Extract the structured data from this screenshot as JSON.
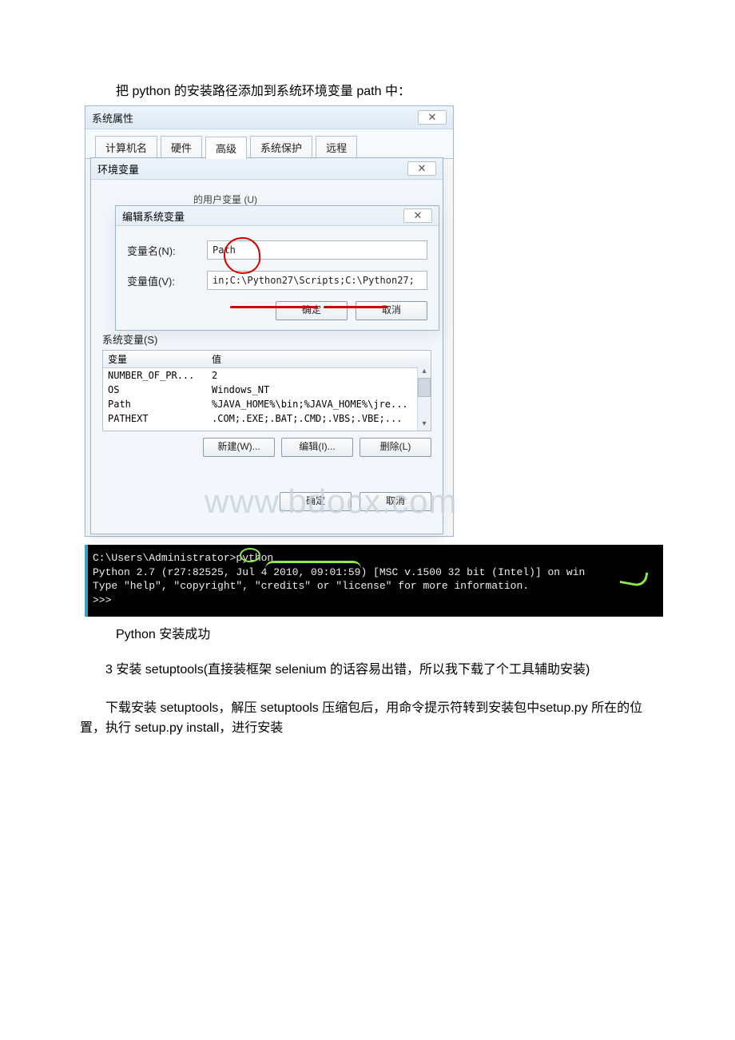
{
  "text": {
    "intro": "把 python 的安装路径添加到系统环境变量 path 中：",
    "caption_success": "Python 安装成功",
    "para_setuptools": "3 安装 setuptools(直接装框架 selenium 的话容易出错，所以我下载了个工具辅助安装)",
    "para_setup_instructions": "下载安装 setuptools，解压 setuptools 压缩包后，用命令提示符转到安装包中setup.py 所在的位置，执行 setup.py install，进行安装"
  },
  "watermark": "www.bdocx.com",
  "sysprop": {
    "title": "系统属性",
    "close": "✕",
    "tabs": {
      "t1": "计算机名",
      "t2": "硬件",
      "t3": "高级",
      "t4": "系统保护",
      "t5": "远程"
    }
  },
  "env": {
    "title": "环境变量",
    "close": "✕",
    "partial_user_vars": "的用户变量 (U)",
    "sysvars_label": "系统变量(S)",
    "col_var": "变量",
    "col_val": "值",
    "rows": [
      {
        "k": "NUMBER_OF_PR...",
        "v": "2"
      },
      {
        "k": "OS",
        "v": "Windows_NT"
      },
      {
        "k": "Path",
        "v": "%JAVA_HOME%\\bin;%JAVA_HOME%\\jre..."
      },
      {
        "k": "PATHEXT",
        "v": ".COM;.EXE;.BAT;.CMD;.VBS;.VBE;..."
      }
    ],
    "btn_new": "新建(W)...",
    "btn_edit": "编辑(I)...",
    "btn_del": "删除(L)",
    "btn_ok": "确定",
    "btn_cancel": "取消"
  },
  "edit": {
    "title": "编辑系统变量",
    "close": "✕",
    "name_label": "变量名(N):",
    "value_label": "变量值(V):",
    "name_value": "Path",
    "value_value": "in;C:\\Python27\\Scripts;C:\\Python27;",
    "btn_ok": "确定",
    "btn_cancel": "取消"
  },
  "terminal": {
    "line1": "C:\\Users\\Administrator>python",
    "line2": "Python 2.7 (r27:82525, Jul  4 2010, 09:01:59) [MSC v.1500 32 bit (Intel)] on win",
    "line3": "Type \"help\", \"copyright\", \"credits\" or \"license\" for more information.",
    "line4": ">>>"
  }
}
